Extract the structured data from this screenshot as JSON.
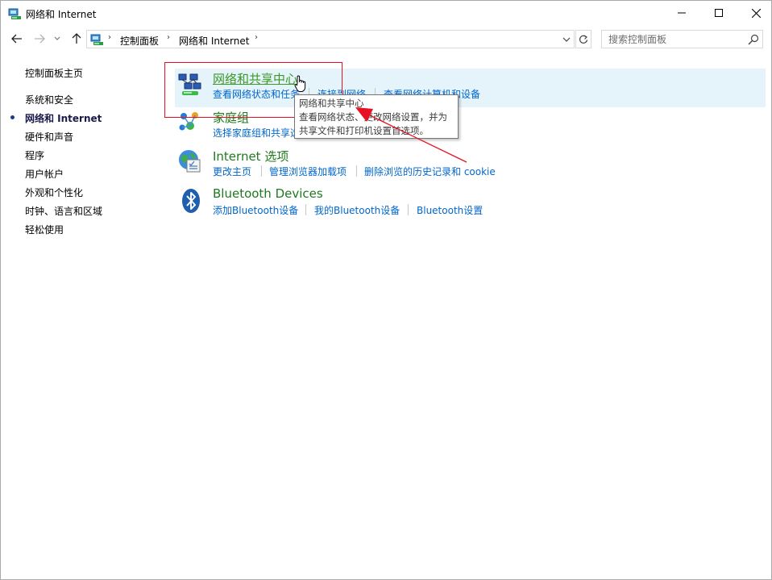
{
  "window": {
    "title": "网络和 Internet",
    "buttons": {
      "minimize": "minimize-icon",
      "maximize": "maximize-icon",
      "close": "close-icon"
    }
  },
  "address": {
    "crumbs": [
      "控制面板",
      "网络和 Internet"
    ],
    "search_placeholder": "搜索控制面板"
  },
  "sidebar": {
    "items": [
      {
        "label": "控制面板主页",
        "current": false
      },
      {
        "label": "系统和安全",
        "current": false
      },
      {
        "label": "网络和 Internet",
        "current": true
      },
      {
        "label": "硬件和声音",
        "current": false
      },
      {
        "label": "程序",
        "current": false
      },
      {
        "label": "用户帐户",
        "current": false
      },
      {
        "label": "外观和个性化",
        "current": false
      },
      {
        "label": "时钟、语言和区域",
        "current": false
      },
      {
        "label": "轻松使用",
        "current": false
      }
    ]
  },
  "categories": [
    {
      "title": "网络和共享中心",
      "icon": "network-sharing-icon",
      "links": [
        "查看网络状态和任务",
        "连接到网络",
        "查看网络计算机和设备"
      ]
    },
    {
      "title": "家庭组",
      "icon": "homegroup-icon",
      "links": [
        "选择家庭组和共享选项"
      ]
    },
    {
      "title": "Internet 选项",
      "icon": "internet-options-icon",
      "links": [
        "更改主页",
        "管理浏览器加载项",
        "删除浏览的历史记录和 cookie"
      ]
    },
    {
      "title": "Bluetooth Devices",
      "icon": "bluetooth-icon",
      "links": [
        "添加Bluetooth设备",
        "我的Bluetooth设备",
        "Bluetooth设置"
      ]
    }
  ],
  "tooltip": {
    "title": "网络和共享中心",
    "lines": [
      "查看网络状态、更改网络设置，并为",
      "共享文件和打印机设置首选项。"
    ]
  },
  "colors": {
    "category_title": "#1e7a1e",
    "link": "#0066cc",
    "highlight": "#e5f3fb",
    "annotation": "#e81123"
  }
}
